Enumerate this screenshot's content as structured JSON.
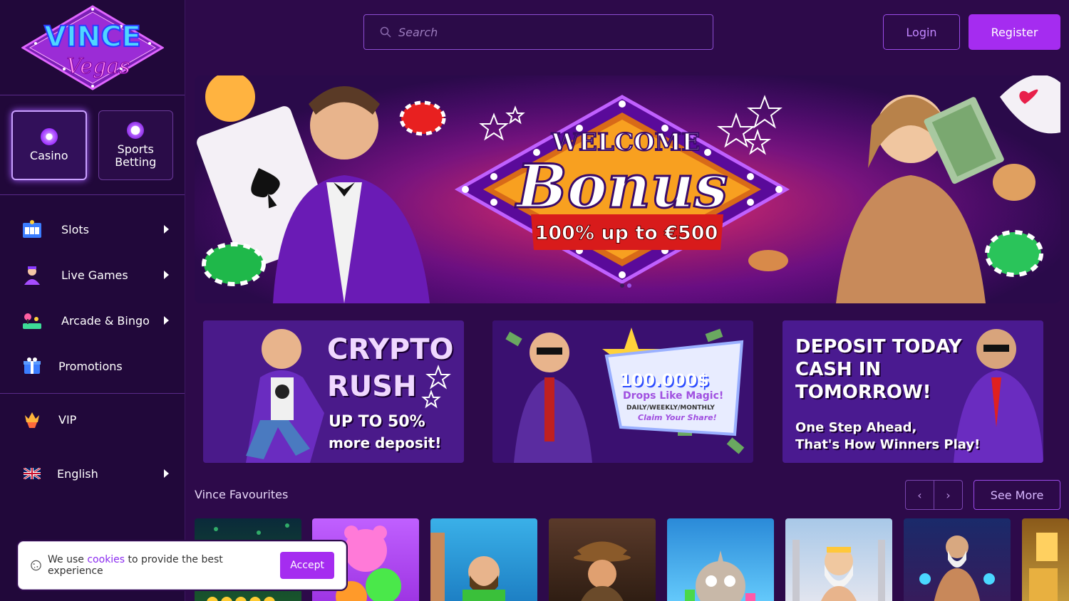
{
  "brand": {
    "logo_line1": "VINCE",
    "logo_line2": "Vegas"
  },
  "modes": [
    {
      "label": "Casino",
      "active": true
    },
    {
      "label": "Sports Betting",
      "active": false
    }
  ],
  "nav": {
    "items": [
      {
        "label": "Slots",
        "icon": "slot-machine-icon",
        "has_arrow": true
      },
      {
        "label": "Live Games",
        "icon": "dealer-icon",
        "has_arrow": true
      },
      {
        "label": "Arcade & Bingo",
        "icon": "arcade-icon",
        "has_arrow": true
      },
      {
        "label": "Promotions",
        "icon": "gift-icon",
        "has_arrow": false
      }
    ],
    "vip": {
      "label": "VIP",
      "icon": "crown-icon"
    },
    "language": {
      "label": "English",
      "icon": "uk-flag-icon"
    }
  },
  "header": {
    "search_placeholder": "Search",
    "login_label": "Login",
    "register_label": "Register"
  },
  "hero": {
    "line1": "WELCOME",
    "line2": "Bonus",
    "ribbon": "100% up to €500",
    "slides": 2,
    "active_slide": 2
  },
  "promos": [
    {
      "line1": "CRYPTO",
      "line2": "RUSH",
      "line3": "UP TO 50%",
      "line4": "more deposit!"
    },
    {
      "line1": "100.000$",
      "line2": "Drops Like Magic!",
      "line3": "DAILY/WEEKLY/MONTHLY",
      "line4": "Claim Your Share!"
    },
    {
      "line1": "DEPOSIT TODAY",
      "line2": "CASH IN",
      "line3": "TOMORROW!",
      "line4": "One Step Ahead,",
      "line5": "That's How Winners Play!"
    }
  ],
  "favourites": {
    "title": "Vince Favourites",
    "prev": "‹",
    "next": "›",
    "see_more": "See More"
  },
  "cookie": {
    "text_before": "We use ",
    "link": "cookies",
    "text_after": " to provide the best experience",
    "accept": "Accept"
  },
  "colors": {
    "accent": "#a52cf0",
    "sidebar": "#21083a",
    "bg": "#2d0a4a"
  }
}
